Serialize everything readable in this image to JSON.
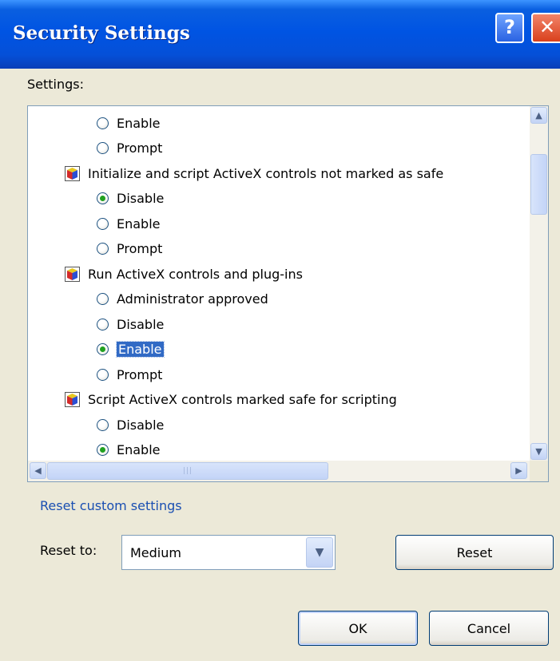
{
  "window": {
    "title": "Security Settings",
    "help_button": "?",
    "close_button": "✕"
  },
  "settings": {
    "label": "Settings:",
    "rows": [
      {
        "kind": "radio",
        "label": "Enable",
        "checked": false
      },
      {
        "kind": "radio",
        "label": "Prompt",
        "checked": false
      },
      {
        "kind": "group",
        "label": "Initialize and script ActiveX controls not marked as safe"
      },
      {
        "kind": "radio",
        "label": "Disable",
        "checked": true
      },
      {
        "kind": "radio",
        "label": "Enable",
        "checked": false
      },
      {
        "kind": "radio",
        "label": "Prompt",
        "checked": false
      },
      {
        "kind": "group",
        "label": "Run ActiveX controls and plug-ins"
      },
      {
        "kind": "radio",
        "label": "Administrator approved",
        "checked": false
      },
      {
        "kind": "radio",
        "label": "Disable",
        "checked": false
      },
      {
        "kind": "radio",
        "label": "Enable",
        "checked": true,
        "selected": true
      },
      {
        "kind": "radio",
        "label": "Prompt",
        "checked": false
      },
      {
        "kind": "group",
        "label": "Script ActiveX controls marked safe for scripting"
      },
      {
        "kind": "radio",
        "label": "Disable",
        "checked": false
      },
      {
        "kind": "radio",
        "label": "Enable",
        "checked": true
      }
    ]
  },
  "reset_group": {
    "heading": "Reset custom settings",
    "reset_to_label": "Reset to:",
    "selected_level": "Medium",
    "reset_button": "Reset"
  },
  "footer": {
    "ok_button": "OK",
    "cancel_button": "Cancel"
  }
}
